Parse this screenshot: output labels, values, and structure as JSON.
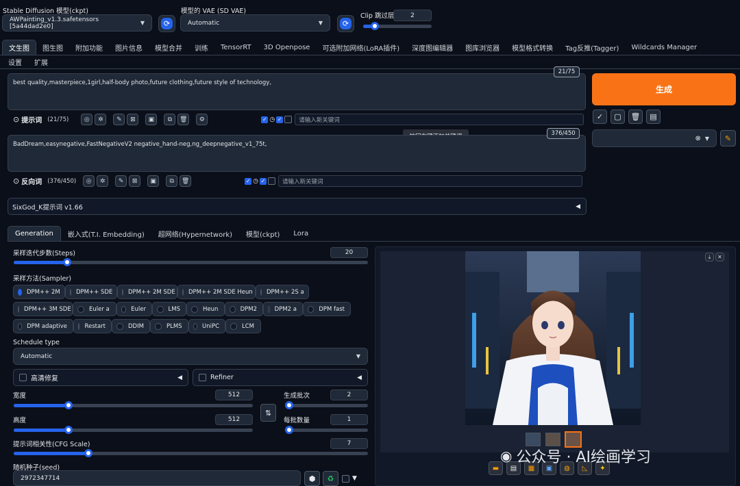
{
  "top": {
    "ckpt_label": "Stable Diffusion 模型(ckpt)",
    "ckpt_value": "AWPainting_v1.3.safetensors [5a44dad2e0]",
    "vae_label": "模型的 VAE (SD VAE)",
    "vae_value": "Automatic",
    "clip_label": "Clip 跳过层",
    "clip_value": "2",
    "clip_fraction": 0.17
  },
  "tabs": [
    "文生图",
    "图生图",
    "附加功能",
    "图片信息",
    "模型合并",
    "训练",
    "TensorRT",
    "3D Openpose",
    "可选附加网络(LoRA插件)",
    "深度图编辑器",
    "图库浏览器",
    "模型格式转换",
    "Tag反推(Tagger)",
    "Wildcards Manager"
  ],
  "tabs_row2": [
    "设置",
    "扩展"
  ],
  "prompt": {
    "text": "best quality,masterpiece,1girl,half-body photo,future clothing,future style of technology,",
    "count": "21/75",
    "title": "提示词",
    "title_count": "(21/75)",
    "kw_placeholder": "请输入新关键词",
    "tooltip": "按回车键添加关键词"
  },
  "negative": {
    "text": "BadDream,easynegative,FastNegativeV2 negative_hand-neg,ng_deepnegative_v1_75t,",
    "count": "376/450",
    "title": "反向词",
    "title_count": "(376/450)",
    "kw_placeholder": "请输入新关键词"
  },
  "generate_label": "生成",
  "sixgod_label": "SixGod_K提示词 v1.66",
  "subtabs": [
    "Generation",
    "嵌入式(T.I. Embedding)",
    "超网络(Hypernetwork)",
    "模型(ckpt)",
    "Lora"
  ],
  "steps": {
    "label": "采样迭代步数(Steps)",
    "value": "20",
    "fraction": 0.15
  },
  "sampler": {
    "label": "采样方法(Sampler)",
    "selected": "DPM++ 2M",
    "options": [
      "DPM++ 2M",
      "DPM++ SDE",
      "DPM++ 2M SDE",
      "DPM++ 2M SDE Heun",
      "DPM++ 2S a",
      "DPM++ 3M SDE",
      "Euler a",
      "Euler",
      "LMS",
      "Heun",
      "DPM2",
      "DPM2 a",
      "DPM fast",
      "DPM adaptive",
      "Restart",
      "DDIM",
      "PLMS",
      "UniPC",
      "LCM"
    ]
  },
  "schedule": {
    "label": "Schedule type",
    "value": "Automatic"
  },
  "hires_label": "高清修复",
  "refiner_label": "Refiner",
  "width": {
    "label": "宽度",
    "value": "512",
    "fraction": 0.23
  },
  "height": {
    "label": "高度",
    "value": "512",
    "fraction": 0.23
  },
  "batch_count": {
    "label": "生成批次",
    "value": "2",
    "fraction": 0.05
  },
  "batch_size": {
    "label": "每批数量",
    "value": "1",
    "fraction": 0.0
  },
  "cfg": {
    "label": "提示词相关性(CFG Scale)",
    "value": "7",
    "fraction": 0.2
  },
  "seed": {
    "label": "随机种子(seed)",
    "value": "2972347714"
  },
  "watermark": "公众号 · AI绘画学习",
  "colors": {
    "accent": "#2563eb",
    "generate": "#f97316",
    "bg": "#0b0f19"
  }
}
